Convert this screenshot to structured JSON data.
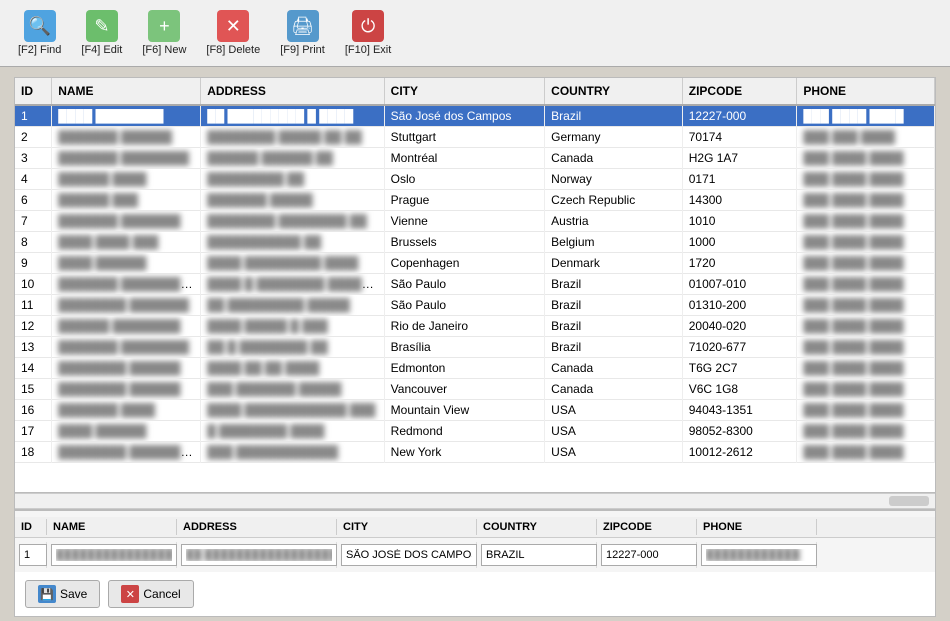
{
  "toolbar": {
    "buttons": [
      {
        "label": "[F2] Find",
        "key": "F2",
        "icon": "🔍",
        "icon_class": "icon-find",
        "name": "find-button"
      },
      {
        "label": "[F4] Edit",
        "key": "F4",
        "icon": "✎",
        "icon_class": "icon-edit",
        "name": "edit-button"
      },
      {
        "label": "[F6] New",
        "key": "F6",
        "icon": "+",
        "icon_class": "icon-new",
        "name": "new-button"
      },
      {
        "label": "[F8] Delete",
        "key": "F8",
        "icon": "✕",
        "icon_class": "icon-delete",
        "name": "delete-button"
      },
      {
        "label": "[F9] Print",
        "key": "F9",
        "icon": "🖨",
        "icon_class": "icon-print",
        "name": "print-button"
      },
      {
        "label": "[F10] Exit",
        "key": "F10",
        "icon": "⏻",
        "icon_class": "icon-exit",
        "name": "exit-button"
      }
    ]
  },
  "table": {
    "columns": [
      "ID",
      "NAME",
      "ADDRESS",
      "CITY",
      "COUNTRY",
      "ZIPCODE",
      "PHONE"
    ],
    "rows": [
      {
        "id": 1,
        "name": "████ ████████",
        "address": "██ █████████ █ ████",
        "city": "São José dos Campos",
        "country": "Brazil",
        "zipcode": "12227-000",
        "phone": "███ ████ ████",
        "selected": true
      },
      {
        "id": 2,
        "name": "███████ ██████",
        "address": "████████ █████ ██ ██",
        "city": "Stuttgart",
        "country": "Germany",
        "zipcode": "70174",
        "phone": "███ ███ ████",
        "selected": false
      },
      {
        "id": 3,
        "name": "███████ ████████",
        "address": "██████ ██████ ██",
        "city": "Montréal",
        "country": "Canada",
        "zipcode": "H2G 1A7",
        "phone": "███ ████ ████",
        "selected": false
      },
      {
        "id": 4,
        "name": "██████ ████",
        "address": "█████████ ██",
        "city": "Oslo",
        "country": "Norway",
        "zipcode": "0171",
        "phone": "███ ████ ████",
        "selected": false
      },
      {
        "id": 6,
        "name": "██████ ███",
        "address": "███████ █████",
        "city": "Prague",
        "country": "Czech Republic",
        "zipcode": "14300",
        "phone": "███ ████ ████",
        "selected": false
      },
      {
        "id": 7,
        "name": "███████ ███████",
        "address": "████████ ████████ ██",
        "city": "Vienne",
        "country": "Austria",
        "zipcode": "1010",
        "phone": "███ ████ ████",
        "selected": false
      },
      {
        "id": 8,
        "name": "████ ████ ███",
        "address": "███████████ ██",
        "city": "Brussels",
        "country": "Belgium",
        "zipcode": "1000",
        "phone": "███ ████ ████",
        "selected": false
      },
      {
        "id": 9,
        "name": "████ ██████",
        "address": "████ █████████ ████",
        "city": "Copenhagen",
        "country": "Denmark",
        "zipcode": "1720",
        "phone": "███ ████ ████",
        "selected": false
      },
      {
        "id": 10,
        "name": "███████ █████████",
        "address": "████ █ ████████ █████ ██",
        "city": "São Paulo",
        "country": "Brazil",
        "zipcode": "01007-010",
        "phone": "███ ████ ████",
        "selected": false
      },
      {
        "id": 11,
        "name": "████████ ███████",
        "address": "██ █████████ █████",
        "city": "São Paulo",
        "country": "Brazil",
        "zipcode": "01310-200",
        "phone": "███ ████ ████",
        "selected": false
      },
      {
        "id": 12,
        "name": "██████ ████████",
        "address": "████ █████ █ ███",
        "city": "Rio de Janeiro",
        "country": "Brazil",
        "zipcode": "20040-020",
        "phone": "███ ████ ████",
        "selected": false
      },
      {
        "id": 13,
        "name": "███████ ████████",
        "address": "██ █ ████████ ██",
        "city": "Brasília",
        "country": "Brazil",
        "zipcode": "71020-677",
        "phone": "███ ████ ████",
        "selected": false
      },
      {
        "id": 14,
        "name": "████████ ██████",
        "address": "████ ██ ██ ████",
        "city": "Edmonton",
        "country": "Canada",
        "zipcode": "T6G 2C7",
        "phone": "███ ████ ████",
        "selected": false
      },
      {
        "id": 15,
        "name": "████████ ██████",
        "address": "███ ███████ █████",
        "city": "Vancouver",
        "country": "Canada",
        "zipcode": "V6C 1G8",
        "phone": "███ ████ ████",
        "selected": false
      },
      {
        "id": 16,
        "name": "███████ ████",
        "address": "████ ████████████ ███",
        "city": "Mountain View",
        "country": "USA",
        "zipcode": "94043-1351",
        "phone": "███ ████ ████",
        "selected": false
      },
      {
        "id": 17,
        "name": "████ ██████",
        "address": "█ ████████ ████",
        "city": "Redmond",
        "country": "USA",
        "zipcode": "98052-8300",
        "phone": "███ ████ ████",
        "selected": false
      },
      {
        "id": 18,
        "name": "████████ ████████",
        "address": "███ ████████████",
        "city": "New York",
        "country": "USA",
        "zipcode": "10012-2612",
        "phone": "███ ████ ████",
        "selected": false
      }
    ]
  },
  "edit_form": {
    "headers": [
      "ID",
      "NAME",
      "ADDRESS",
      "CITY",
      "COUNTRY",
      "ZIPCODE",
      "PHONE"
    ],
    "id_value": "1",
    "name_value": "████████████████████",
    "address_value": "██ ████████████████████",
    "city_value": "SÃO JOSÉ DOS CAMPOS",
    "country_value": "BRAZIL",
    "zipcode_value": "12227-000",
    "phone_value": "████████████"
  },
  "save_button_label": "Save",
  "cancel_button_label": "Cancel"
}
